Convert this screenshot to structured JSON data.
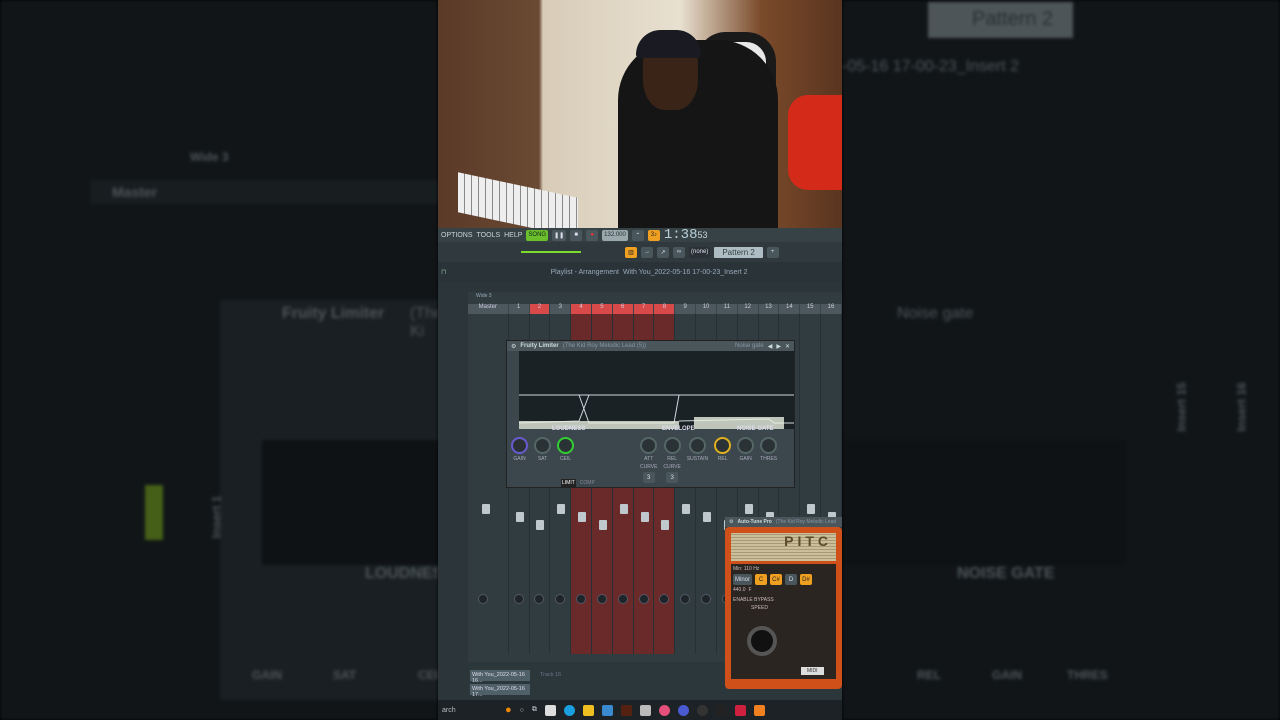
{
  "blurred_left": {
    "plugin_title": "Fruity Limiter",
    "plugin_sub": "(The Ki",
    "loudness": "LOUDNESS",
    "knobs": [
      "GAIN",
      "SAT",
      "CEIL"
    ],
    "insert": "Insert 1",
    "master": "Master",
    "wide": "Wide 3"
  },
  "blurred_right": {
    "pattern": "Pattern 2",
    "breadcrumb": "-05-16 17-00-23_Insert 2",
    "preset": "Noise gate",
    "section": "NOISE GATE",
    "knobs": [
      "REL",
      "GAIN",
      "THRES"
    ],
    "inserts": [
      "Insert 15",
      "Insert 16"
    ]
  },
  "menu": {
    "items": [
      "OPTIONS",
      "TOOLS",
      "HELP"
    ],
    "song_mode": "SONG",
    "tempo": "132.000",
    "time": "1:38",
    "time_sub": "53"
  },
  "toolbar2": {
    "preset_select": "(none)",
    "pattern": "Pattern 2"
  },
  "playlist_bar": {
    "title": "Playlist - Arrangement",
    "breadcrumb": "With You_2022-05-16 17-00-23_Insert 2",
    "ruler": [
      "1",
      "2",
      "3",
      "4",
      "5",
      "6",
      "7",
      "8",
      "9",
      "10",
      "11",
      "12"
    ]
  },
  "mixer": {
    "preset": "Wide 3",
    "master": "Master",
    "channels": [
      "1",
      "2",
      "3",
      "4",
      "5",
      "6",
      "7",
      "8",
      "9",
      "10",
      "11",
      "12",
      "13",
      "14",
      "15",
      "16"
    ],
    "selected_channels": [
      "4",
      "5",
      "6",
      "7",
      "8"
    ],
    "current": "2"
  },
  "limiter": {
    "title": "Fruity Limiter",
    "subtitle": "(The Kid Roy Melodic Lead (5))",
    "preset": "Noise gate",
    "sections": [
      "LOUDNESS",
      "ENVELOPE",
      "NOISE GATE"
    ],
    "knobs": [
      "GAIN",
      "SAT",
      "CEIL",
      "ATT",
      "REL",
      "SUSTAIN",
      "REL",
      "GAIN",
      "THRES"
    ],
    "curve_label": "CURVE",
    "curve_values": [
      "3",
      "3"
    ],
    "tabs": [
      "LIMIT",
      "COMP"
    ]
  },
  "autotune": {
    "title": "Auto-Tune Pro",
    "subtitle": "(The Kid Roy Melodic Lead",
    "logo": "PITC",
    "min": "Min: 110 Hz",
    "scale": "Minor",
    "ref": "440.0",
    "key": "F",
    "notes": [
      "C",
      "C#",
      "D",
      "D#"
    ],
    "bypass": "ENABLE BYPASS",
    "speed": "SPEED",
    "midi": "MIDI"
  },
  "playlist": {
    "tracks": [
      "With You_2022-05-16 16...",
      "With You_2022-05-16 17..."
    ],
    "track_label": "Track 16"
  },
  "taskbar": {
    "search": "arch"
  },
  "colors": {
    "accent": "#f0a020",
    "selected": "#d84a4a",
    "green": "#6bbf2a"
  }
}
